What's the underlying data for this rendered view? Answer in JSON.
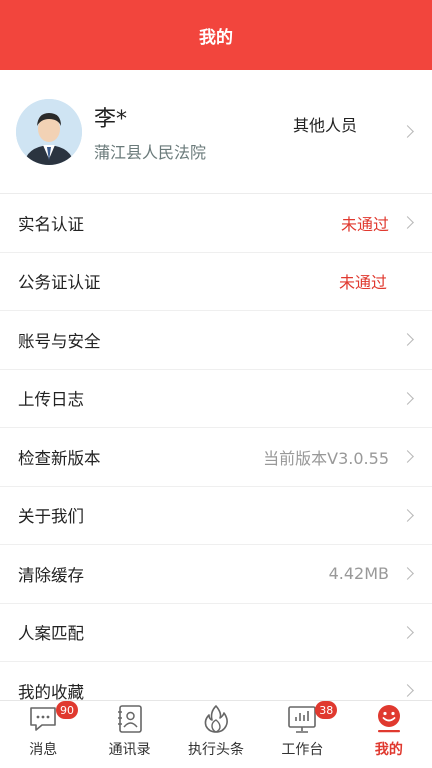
{
  "header": {
    "title": "我的"
  },
  "profile": {
    "name": "李*",
    "org": "蒲江县人民法院",
    "role": "其他人员"
  },
  "menu": [
    {
      "label": "实名认证",
      "value": "未通过",
      "value_color": "#e0392f",
      "chevron": true
    },
    {
      "label": "公务证认证",
      "value": "未通过",
      "value_color": "#e0392f",
      "chevron": false
    },
    {
      "label": "账号与安全",
      "value": "",
      "chevron": true
    },
    {
      "label": "上传日志",
      "value": "",
      "chevron": true
    },
    {
      "label": "检查新版本",
      "value": "当前版本V3.0.55",
      "chevron": true
    },
    {
      "label": "关于我们",
      "value": "",
      "chevron": true
    },
    {
      "label": "清除缓存",
      "value": "4.42MB",
      "chevron": true
    },
    {
      "label": "人案匹配",
      "value": "",
      "chevron": true
    },
    {
      "label": "我的收藏",
      "value": "",
      "chevron": true
    }
  ],
  "tabs": [
    {
      "label": "消息",
      "icon": "message-icon",
      "badge": "90"
    },
    {
      "label": "通讯录",
      "icon": "contacts-icon",
      "badge": ""
    },
    {
      "label": "执行头条",
      "icon": "fire-icon",
      "badge": ""
    },
    {
      "label": "工作台",
      "icon": "workbench-icon",
      "badge": "38"
    },
    {
      "label": "我的",
      "icon": "smile-icon",
      "badge": "",
      "active": true
    }
  ],
  "colors": {
    "brand": "#f2453d",
    "alert": "#e0392f"
  }
}
